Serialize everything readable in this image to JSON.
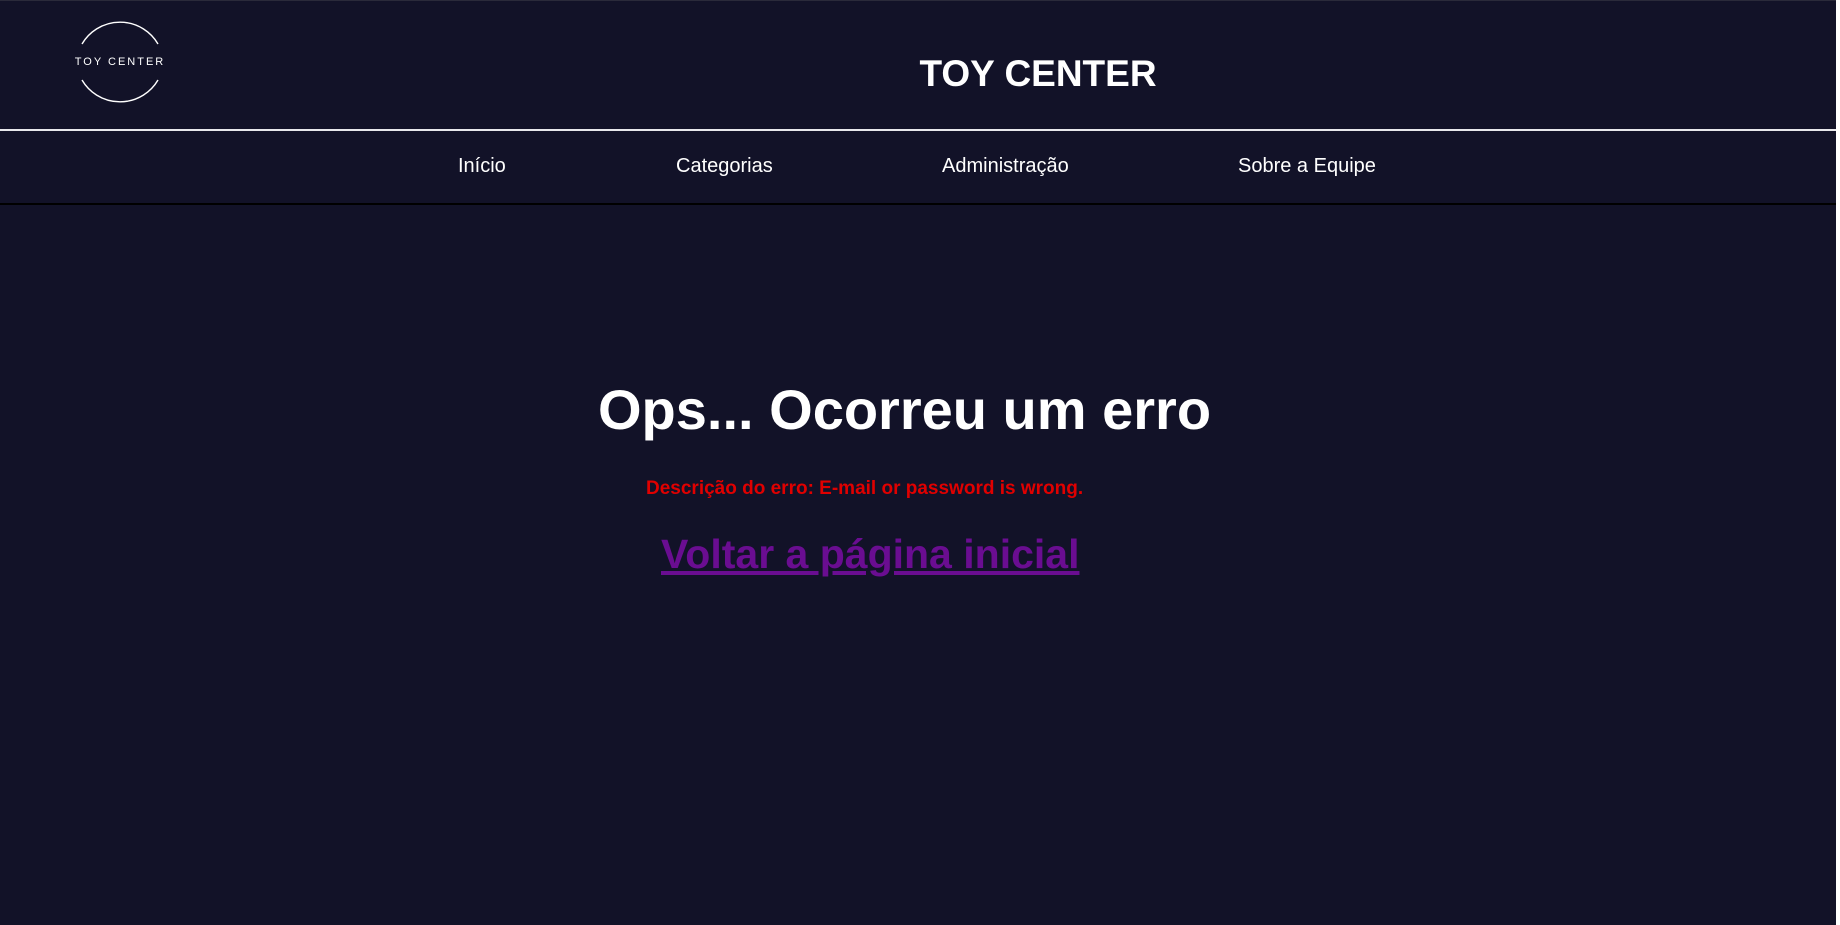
{
  "header": {
    "logo_text": "TOY CENTER",
    "site_title": "TOY CENTER"
  },
  "nav": {
    "items": [
      {
        "label": "Início"
      },
      {
        "label": "Categorias"
      },
      {
        "label": "Administração"
      },
      {
        "label": "Sobre a Equipe"
      }
    ]
  },
  "main": {
    "heading": "Ops... Ocorreu um erro",
    "error_description": "Descrição do erro: E-mail or password is wrong.",
    "back_link": "Voltar a página inicial"
  },
  "colors": {
    "background": "#121228",
    "text": "#ffffff",
    "error": "#e00000",
    "link": "#6a0d91"
  }
}
